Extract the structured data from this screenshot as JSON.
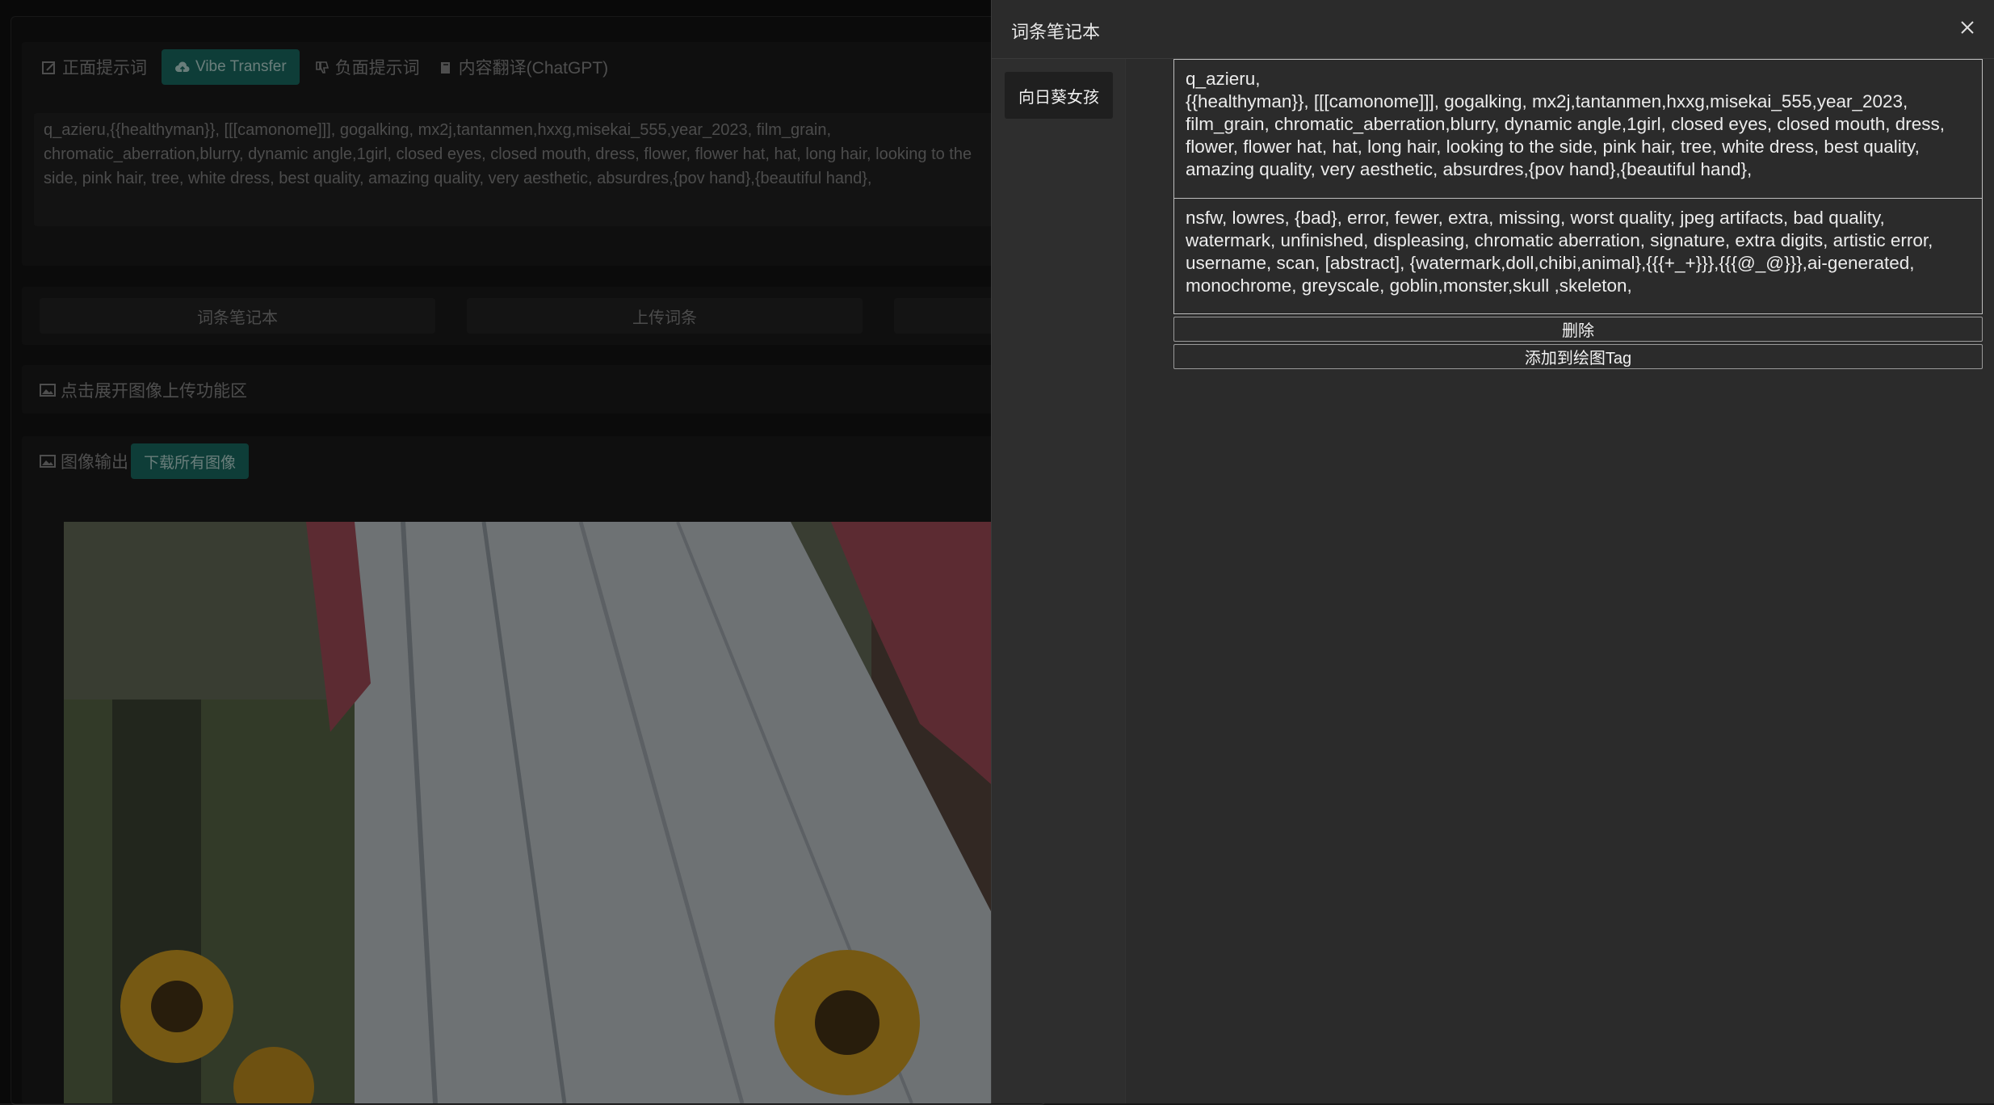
{
  "background": {
    "tabs": [
      {
        "label": "正面提示词"
      },
      {
        "label": "Vibe Transfer"
      },
      {
        "label": "负面提示词"
      },
      {
        "label": "内容翻译(ChatGPT)"
      }
    ],
    "prompt_text": "q_azieru,{{healthyman}}, [[[camonome]]], gogalking, mx2j,tantanmen,hxxg,misekai_555,year_2023, film_grain, chromatic_aberration,blurry, dynamic angle,1girl, closed eyes, closed mouth, dress, flower, flower hat, hat, long hair, looking to the side, pink hair, tree, white dress, best quality, amazing quality, very aesthetic, absurdres,{pov hand},{beautiful hand},",
    "buttons": [
      {
        "label": "词条笔记本"
      },
      {
        "label": "上传词条"
      }
    ],
    "upload_section": "点击展开图像上传功能区",
    "output_section": "图像输出",
    "download_all": "下载所有图像"
  },
  "drawer": {
    "title": "词条笔记本",
    "entries": [
      {
        "name": "向日葵女孩"
      }
    ],
    "positive": "q_azieru,\n{{healthyman}}, [[[camonome]]], gogalking, mx2j,tantanmen,hxxg,misekai_555,year_2023, film_grain, chromatic_aberration,blurry, dynamic angle,1girl, closed eyes, closed mouth, dress, flower, flower hat, hat, long hair, looking to the side, pink hair, tree, white dress, best quality, amazing quality, very aesthetic, absurdres,{pov hand},{beautiful hand},",
    "negative": "nsfw, lowres, {bad}, error, fewer, extra, missing, worst quality, jpeg artifacts, bad quality, watermark, unfinished, displeasing, chromatic aberration, signature, extra digits, artistic error, username, scan, [abstract], {watermark,doll,chibi,animal},{{{+_+}}},{{{@_@}}},ai-generated, monochrome, greyscale, goblin,monster,skull ,skeleton,",
    "delete_label": "删除",
    "add_label": "添加到绘图Tag"
  },
  "colors": {
    "accent": "#1b6f66",
    "drawer_bg": "#2b2b2b"
  }
}
